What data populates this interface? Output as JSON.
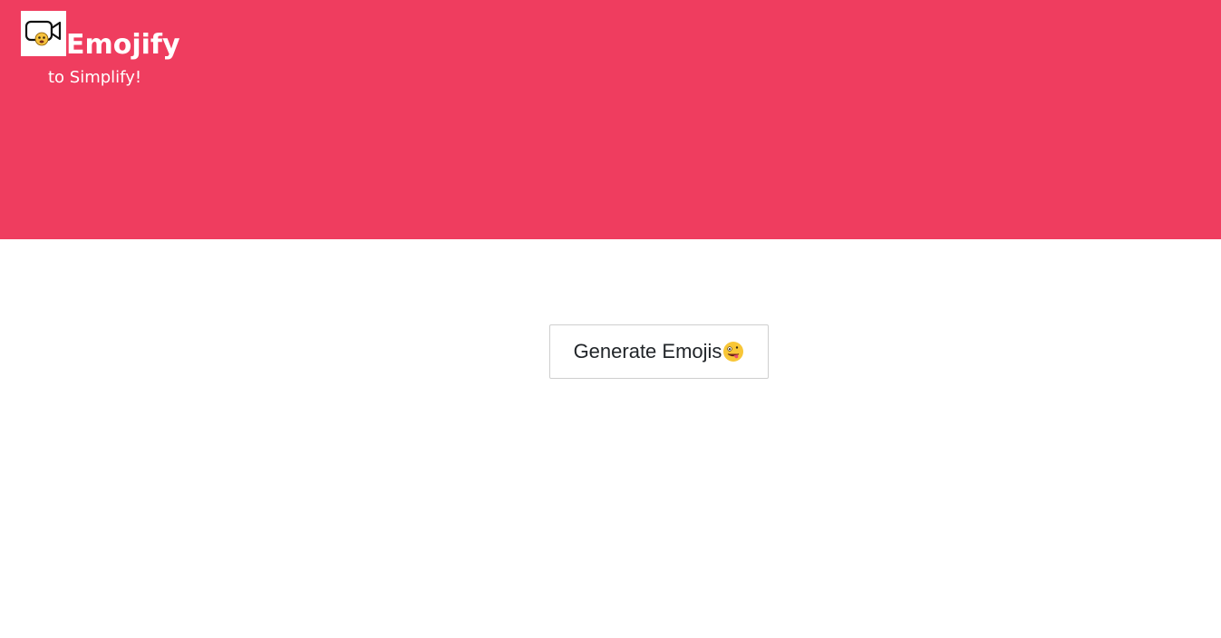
{
  "header": {
    "title": "Emojify",
    "tagline": "to Simplify!",
    "logo_icon": "video-camera-emoji-icon",
    "background_color": "#ef3d5f"
  },
  "main": {
    "generate_button_label": "Generate Emojis",
    "generate_button_icon": "zany-face-emoji-icon"
  }
}
